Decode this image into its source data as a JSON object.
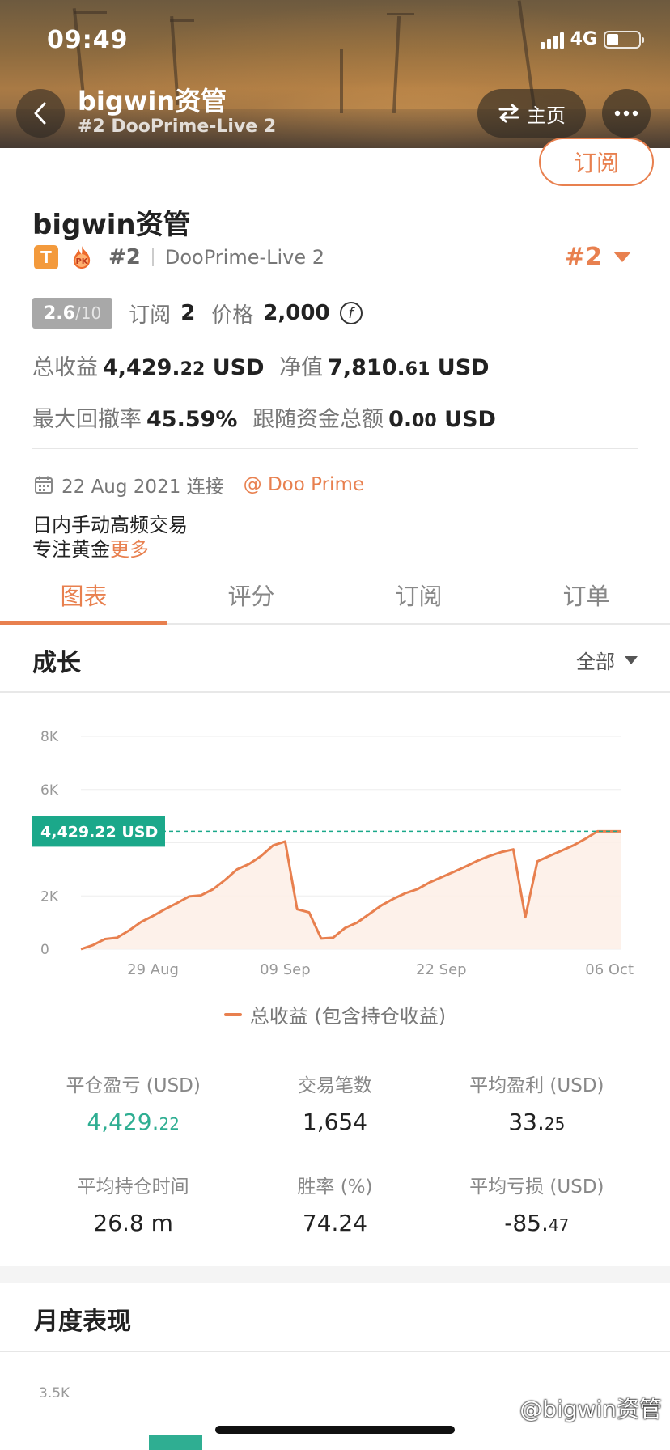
{
  "status_bar": {
    "time": "09:49",
    "network": "4G"
  },
  "header": {
    "title": "bigwin资管",
    "subtitle": "#2 DooPrime-Live 2",
    "home_label": "主页"
  },
  "subscribe_label": "订阅",
  "profile": {
    "name": "bigwin资管",
    "rank_small": "#2",
    "server": "DooPrime-Live 2",
    "rank_big": "#2",
    "score": "2.6",
    "score_max": "/10",
    "subscribe_label": "订阅",
    "subscribe_count": "2",
    "price_label": "价格",
    "price_value": "2,000",
    "total_profit_label": "总收益",
    "total_profit_main": "4,429.",
    "total_profit_dec": "22",
    "net_value_label": "净值",
    "net_value_main": "7,810.",
    "net_value_dec": "61",
    "currency": "USD",
    "max_drawdown_label": "最大回撤率",
    "max_drawdown_value": "45.59%",
    "follow_funds_label": "跟随资金总额",
    "follow_funds_main": "0.",
    "follow_funds_dec": "00",
    "connect_date": "22 Aug 2021 连接",
    "broker": "@ Doo Prime",
    "desc_line1": "日内手动高频交易",
    "desc_line2": "专注黄金",
    "more_label": "更多"
  },
  "tabs": [
    "图表",
    "评分",
    "订阅",
    "订单"
  ],
  "growth": {
    "title": "成长",
    "range_label": "全部"
  },
  "chart_data": {
    "type": "area",
    "series": [
      {
        "name": "总收益 (包含持仓收益)",
        "x": [
          "2021-08-23",
          "2021-08-24",
          "2021-08-25",
          "2021-08-26",
          "2021-08-27",
          "2021-08-28",
          "2021-08-29",
          "2021-08-30",
          "2021-08-31",
          "2021-09-01",
          "2021-09-02",
          "2021-09-03",
          "2021-09-04",
          "2021-09-05",
          "2021-09-06",
          "2021-09-07",
          "2021-09-08",
          "2021-09-09",
          "2021-09-10",
          "2021-09-11",
          "2021-09-12",
          "2021-09-13",
          "2021-09-14",
          "2021-09-15",
          "2021-09-16",
          "2021-09-17",
          "2021-09-18",
          "2021-09-19",
          "2021-09-20",
          "2021-09-21",
          "2021-09-22",
          "2021-09-23",
          "2021-09-24",
          "2021-09-25",
          "2021-09-26",
          "2021-09-27",
          "2021-09-28",
          "2021-09-29",
          "2021-09-30",
          "2021-10-01",
          "2021-10-02",
          "2021-10-03",
          "2021-10-04",
          "2021-10-05",
          "2021-10-06",
          "2021-10-07"
        ],
        "values": [
          0,
          150,
          380,
          430,
          700,
          1020,
          1250,
          1500,
          1730,
          1980,
          2020,
          2250,
          2600,
          3000,
          3200,
          3500,
          3900,
          4050,
          1500,
          1380,
          400,
          430,
          800,
          1000,
          1320,
          1640,
          1890,
          2100,
          2250,
          2500,
          2700,
          2900,
          3100,
          3320,
          3500,
          3650,
          3750,
          1200,
          3300,
          3500,
          3700,
          3900,
          4150,
          4429,
          4429,
          4429
        ]
      }
    ],
    "y_ticks": [
      "0",
      "2K",
      "6K",
      "8K"
    ],
    "x_ticks": [
      "29 Aug",
      "09 Sep",
      "22 Sep",
      "06 Oct"
    ],
    "ylim": [
      0,
      8000
    ],
    "current_label": "4,429.22 USD",
    "legend": "总收益 (包含持仓收益)",
    "colors": {
      "line": "#e8804f",
      "fill": "#fdeee6",
      "marker": "#1ba88a"
    }
  },
  "metrics": [
    {
      "label": "平仓盈亏 (USD)",
      "main": "4,429.",
      "dec": "22"
    },
    {
      "label": "交易笔数",
      "main": "1,654",
      "dec": ""
    },
    {
      "label": "平均盈利 (USD)",
      "main": "33.",
      "dec": "25"
    },
    {
      "label": "平均持仓时间",
      "main": "26.8 m",
      "dec": ""
    },
    {
      "label": "胜率 (%)",
      "main": "74.24",
      "dec": ""
    },
    {
      "label": "平均亏损 (USD)",
      "main": "-85.",
      "dec": "47"
    }
  ],
  "monthly": {
    "title": "月度表现",
    "axis_top": "3.5K"
  },
  "watermark": "@bigwin资管",
  "colors": {
    "accent": "#e8804f",
    "green": "#2fae92"
  }
}
